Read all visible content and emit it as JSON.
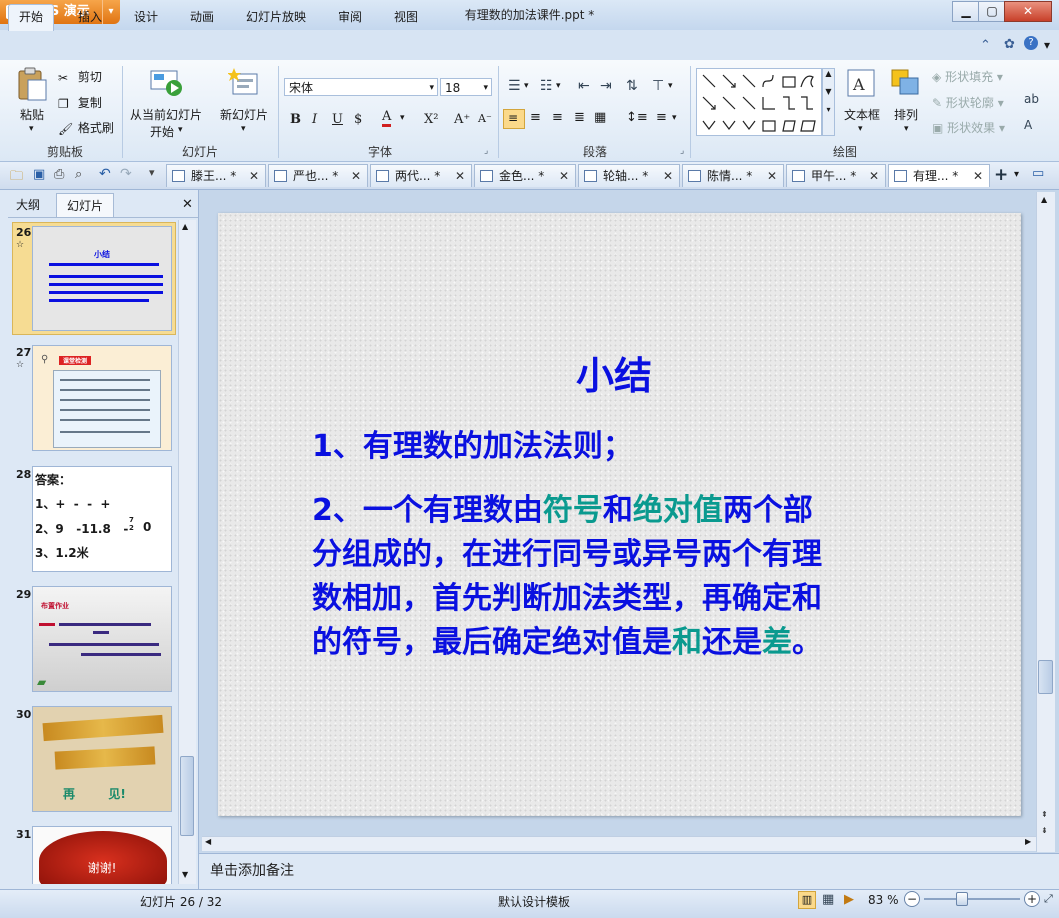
{
  "app": {
    "name": "WPS 演示",
    "title": "有理数的加法课件.ppt *"
  },
  "menu": {
    "tabs": [
      "开始",
      "插入",
      "设计",
      "动画",
      "幻灯片放映",
      "审阅",
      "视图"
    ],
    "active": "开始"
  },
  "ribbon": {
    "clipboard": {
      "label": "剪贴板",
      "paste": "粘贴",
      "cut": "剪切",
      "copy": "复制",
      "format_painter": "格式刷"
    },
    "slides": {
      "label": "幻灯片",
      "from_current_1": "从当前幻灯片",
      "from_current_2": "开始",
      "new_slide": "新幻灯片"
    },
    "font": {
      "label": "字体",
      "name": "宋体",
      "size": "18"
    },
    "paragraph": {
      "label": "段落"
    },
    "drawing": {
      "label": "绘图",
      "textbox": "文本框",
      "arrange": "排列",
      "fill": "形状填充",
      "outline": "形状轮廓",
      "effect": "形状效果"
    }
  },
  "doc_tabs": [
    {
      "label": "滕王... *"
    },
    {
      "label": "严也... *"
    },
    {
      "label": "两代... *"
    },
    {
      "label": "金色... *"
    },
    {
      "label": "轮轴... *"
    },
    {
      "label": "陈情... *"
    },
    {
      "label": "甲午... *"
    },
    {
      "label": "有理... *",
      "active": true
    }
  ],
  "left_panel": {
    "tabs": [
      "大纲",
      "幻灯片"
    ],
    "active": "幻灯片",
    "thumbnails": [
      {
        "num": "26",
        "title": "小结"
      },
      {
        "num": "27",
        "title": "课堂检测"
      },
      {
        "num": "28",
        "lines": [
          "答案：",
          "1、+  -  -  +",
          "2、9   -11.8   -",
          "3、1.2米"
        ],
        "frac_num": "7",
        "frac_den": "2",
        "tail": "0"
      },
      {
        "num": "29",
        "title": "布置作业"
      },
      {
        "num": "30",
        "line1": "再        见!"
      },
      {
        "num": "31",
        "line1": "谢谢!"
      }
    ]
  },
  "slide": {
    "title": "小结",
    "line1": "1、有理数的加法法则；",
    "p2": {
      "a": "2、一个有理数由",
      "b": "符号",
      "c": "和",
      "d": "绝对值",
      "e": "两个部",
      "l2": "分组成的，在进行同号或异号两个有理",
      "l3": "数相加，首先判断加法类型，再确定和",
      "l4a": "的符号，最后确定绝对值是",
      "l4b": "和",
      "l4c": "还是",
      "l4d": "差",
      "l4e": "。"
    }
  },
  "notes_placeholder": "单击添加备注",
  "status": {
    "slide_pos": "幻灯片 26 / 32",
    "template": "默认设计模板",
    "zoom": "83 %"
  },
  "colors": {
    "slide_text": "#0a10e0",
    "teal": "#0a9a8f",
    "accent": "#e07412"
  }
}
